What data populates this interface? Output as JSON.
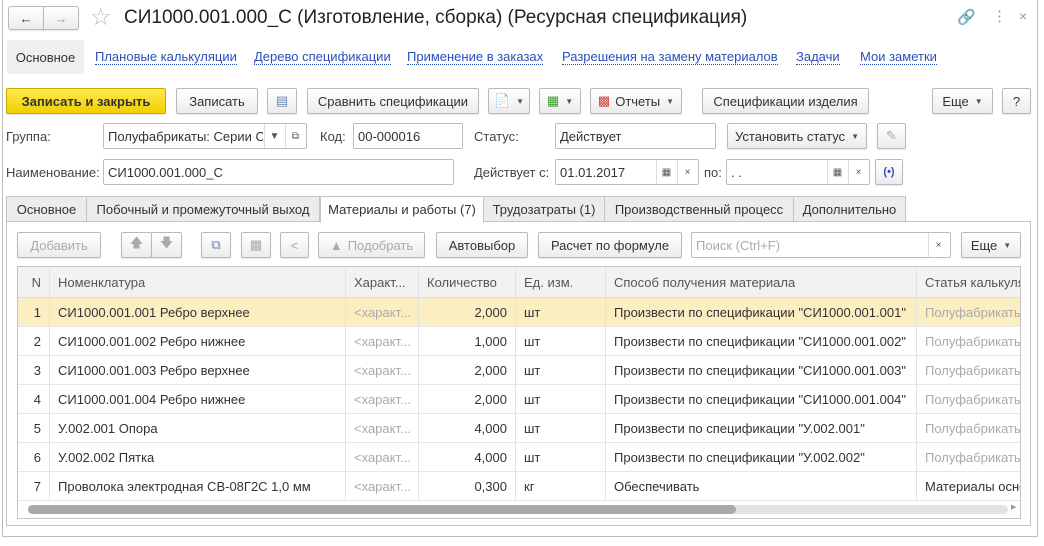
{
  "title": "СИ1000.001.000_С (Изготовление, сборка) (Ресурсная спецификация)",
  "nav": {
    "active": "Основное",
    "links": [
      "Плановые калькуляции",
      "Дерево спецификации",
      "Применение в заказах",
      "Разрешения на замену материалов",
      "Задачи",
      "Мои заметки"
    ]
  },
  "toolbar": {
    "save_close": "Записать и закрыть",
    "save": "Записать",
    "compare": "Сравнить спецификации",
    "reports": "Отчеты",
    "product_specs": "Спецификации изделия",
    "more": "Еще",
    "help": "?"
  },
  "form": {
    "group_label": "Группа:",
    "group_value": "Полуфабрикаты: Серии СИ",
    "code_label": "Код:",
    "code_value": "00-000016",
    "status_label": "Статус:",
    "status_value": "Действует",
    "set_status": "Установить статус",
    "name_label": "Наименование:",
    "name_value": "СИ1000.001.000_С",
    "valid_from_label": "Действует с:",
    "valid_from_value": "01.01.2017",
    "to_label": "по:",
    "to_value": " .  ."
  },
  "tabs": [
    "Основное",
    "Побочный и промежуточный выход",
    "Материалы и работы (7)",
    "Трудозатраты (1)",
    "Производственный процесс",
    "Дополнительно"
  ],
  "inner_toolbar": {
    "add": "Добавить",
    "pick": "Подобрать",
    "auto": "Автовыбор",
    "formula": "Расчет по формуле",
    "search_placeholder": "Поиск (Ctrl+F)",
    "more": "Еще"
  },
  "table": {
    "columns": [
      "N",
      "Номенклатура",
      "Характ...",
      "Количество",
      "Ед. изм.",
      "Способ получения материала",
      "Статья калькуляции"
    ],
    "rows": [
      [
        "1",
        "СИ1000.001.001 Ребро верхнее",
        "<характ...",
        "2,000",
        "шт",
        "Произвести по спецификации \"СИ1000.001.001\"",
        "Полуфабрикаты"
      ],
      [
        "2",
        "СИ1000.001.002 Ребро нижнее",
        "<характ...",
        "1,000",
        "шт",
        "Произвести по спецификации \"СИ1000.001.002\"",
        "Полуфабрикаты"
      ],
      [
        "3",
        "СИ1000.001.003 Ребро верхнее",
        "<характ...",
        "2,000",
        "шт",
        "Произвести по спецификации \"СИ1000.001.003\"",
        "Полуфабрикаты"
      ],
      [
        "4",
        "СИ1000.001.004 Ребро нижнее",
        "<характ...",
        "2,000",
        "шт",
        "Произвести по спецификации \"СИ1000.001.004\"",
        "Полуфабрикаты"
      ],
      [
        "5",
        "У.002.001 Опора",
        "<характ...",
        "4,000",
        "шт",
        "Произвести по спецификации \"У.002.001\"",
        "Полуфабрикаты"
      ],
      [
        "6",
        "У.002.002 Пятка",
        "<характ...",
        "4,000",
        "шт",
        "Произвести по спецификации \"У.002.002\"",
        "Полуфабрикаты"
      ],
      [
        "7",
        "Проволока электродная СВ-08Г2С 1,0 мм",
        "<характ...",
        "0,300",
        "кг",
        "Обеспечивать",
        "Материалы основные"
      ]
    ]
  }
}
